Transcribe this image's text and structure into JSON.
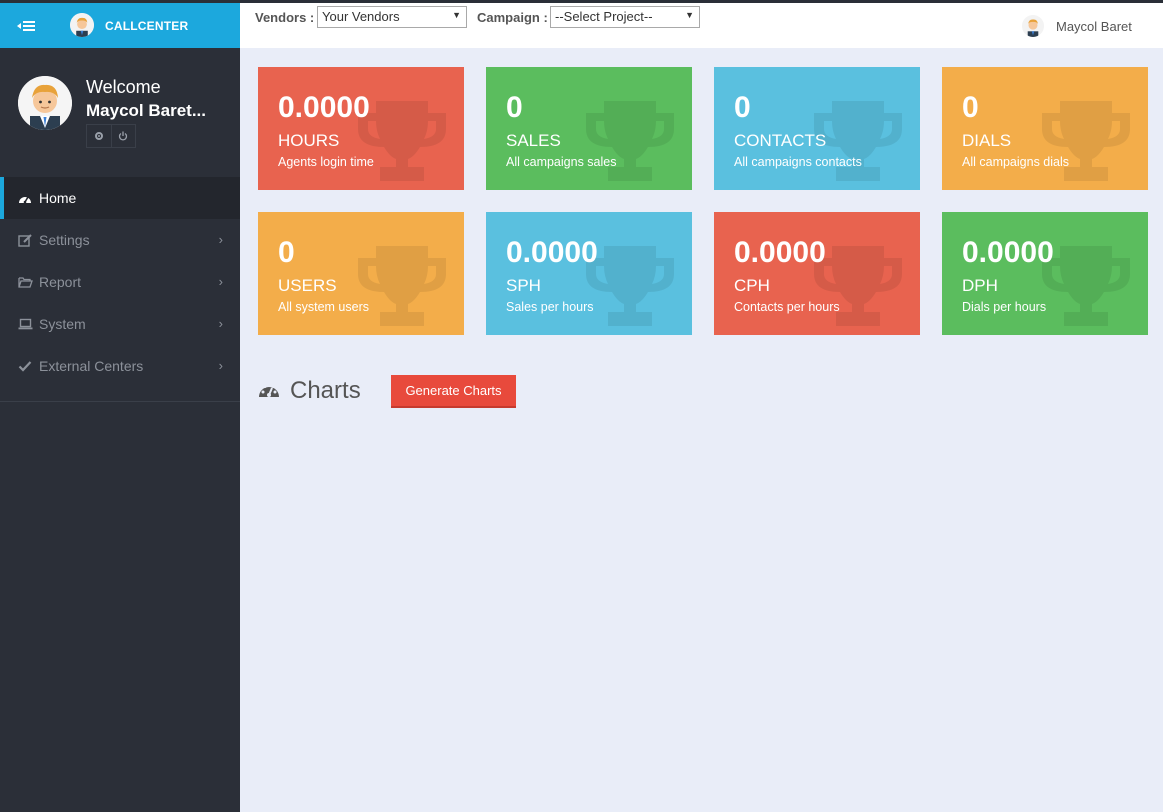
{
  "brand": {
    "title": "CALLCENTER"
  },
  "profile": {
    "welcome": "Welcome",
    "name": "Maycol Baret..."
  },
  "nav": [
    {
      "label": "Home",
      "icon": "dashboard-icon",
      "active": true
    },
    {
      "label": "Settings",
      "icon": "edit-icon"
    },
    {
      "label": "Report",
      "icon": "folder-open-icon"
    },
    {
      "label": "System",
      "icon": "laptop-icon"
    },
    {
      "label": "External Centers",
      "icon": "check-icon"
    }
  ],
  "topbar": {
    "vendors_label": "Vendors :",
    "vendors_value": "Your Vendors",
    "campaign_label": "Campaign :",
    "campaign_value": "--Select Project--",
    "user_name": "Maycol Baret"
  },
  "cards": [
    {
      "value": "0.0000",
      "title": "HOURS",
      "subtitle": "Agents login time",
      "color": "#e8634f"
    },
    {
      "value": "0",
      "title": "SALES",
      "subtitle": "All campaigns sales",
      "color": "#5bbd5e"
    },
    {
      "value": "0",
      "title": "CONTACTS",
      "subtitle": "All campaigns contacts",
      "color": "#5ac0df"
    },
    {
      "value": "0",
      "title": "DIALS",
      "subtitle": "All campaigns dials",
      "color": "#f3ad4a"
    },
    {
      "value": "0",
      "title": "USERS",
      "subtitle": "All system users",
      "color": "#f3ad4a"
    },
    {
      "value": "0.0000",
      "title": "SPH",
      "subtitle": "Sales per hours",
      "color": "#5ac0df"
    },
    {
      "value": "0.0000",
      "title": "CPH",
      "subtitle": "Contacts per hours",
      "color": "#e8634f"
    },
    {
      "value": "0.0000",
      "title": "DPH",
      "subtitle": "Dials per hours",
      "color": "#5bbd5e"
    }
  ],
  "charts": {
    "title": "Charts",
    "button": "Generate Charts"
  }
}
